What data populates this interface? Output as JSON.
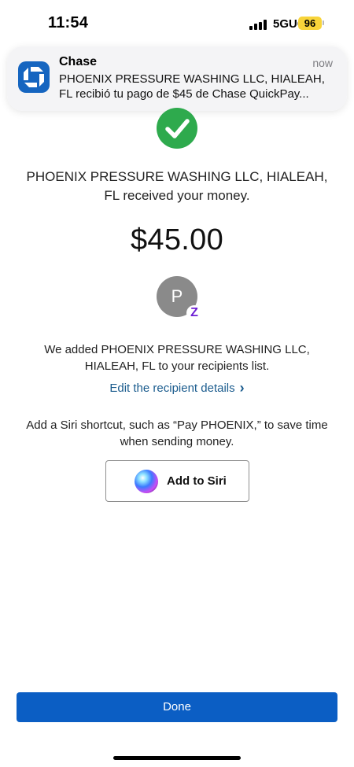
{
  "status_bar": {
    "time": "11:54",
    "network": "5GUC",
    "battery": "96",
    "battery_color": "#f8d43a"
  },
  "notification": {
    "app_name": "Chase",
    "time": "now",
    "line1": "PHOENIX PRESSURE WASHING LLC, HIALEAH,",
    "line2": "FL recibió tu pago de $45 de Chase QuickPay...",
    "icon": "chase-logo-icon",
    "icon_color": "#1565c0"
  },
  "confirmation": {
    "success_icon": "checkmark-circle-icon",
    "success_color": "#2eaa4d",
    "headline_line1": "PHOENIX PRESSURE WASHING LLC, HIALEAH,",
    "headline_line2": "FL received your money.",
    "amount": "$45.00"
  },
  "recipient": {
    "avatar_initial": "P",
    "badge_icon": "zelle-icon",
    "badge_glyph": "Z",
    "added_line1": "We added PHOENIX PRESSURE WASHING LLC,",
    "added_line2": "HIALEAH, FL to your recipients list.",
    "edit_link": "Edit the recipient details",
    "link_color": "#1b5c8e"
  },
  "siri": {
    "text_line1": "Add a Siri shortcut, such as “Pay PHOENIX,” to save time",
    "text_line2": "when sending money.",
    "button_label": "Add to Siri",
    "icon": "siri-icon"
  },
  "footer": {
    "done_label": "Done",
    "done_color": "#0b5ec4"
  }
}
